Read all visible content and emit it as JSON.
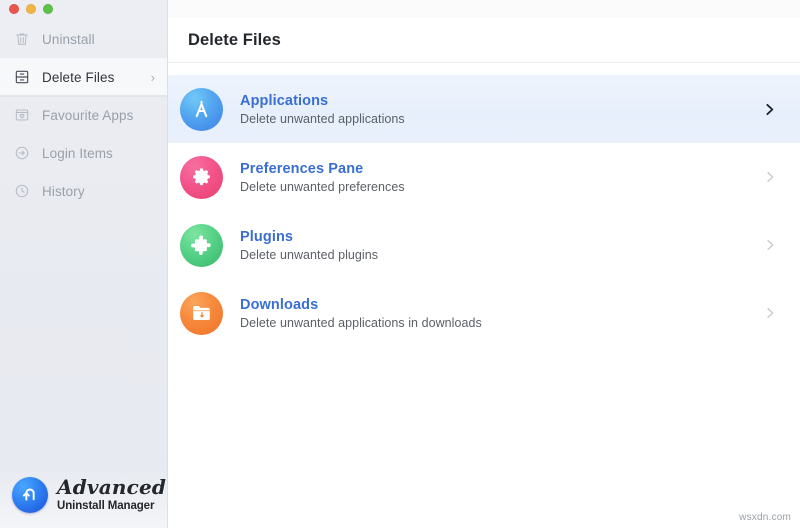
{
  "window": {
    "traffic_lights": [
      {
        "name": "close",
        "color": "#e9554c"
      },
      {
        "name": "minimize",
        "color": "#f1b344"
      },
      {
        "name": "zoom",
        "color": "#5cc149"
      }
    ]
  },
  "sidebar": {
    "items": [
      {
        "label": "Uninstall",
        "icon": "trash-icon",
        "selected": false
      },
      {
        "label": "Delete Files",
        "icon": "drawer-icon",
        "selected": true
      },
      {
        "label": "Favourite Apps",
        "icon": "heart-box-icon",
        "selected": false
      },
      {
        "label": "Login Items",
        "icon": "login-arrow-icon",
        "selected": false
      },
      {
        "label": "History",
        "icon": "clock-icon",
        "selected": false
      }
    ],
    "chevron": "›",
    "brand": {
      "logo": "u-turn-arrow-logo",
      "name": "Advanced",
      "tagline": "Uninstall Manager"
    }
  },
  "main": {
    "header": {
      "title": "Delete Files"
    },
    "rows": [
      {
        "title": "Applications",
        "subtitle": "Delete unwanted applications",
        "icon": "compass-icon",
        "icon_color": "#3d7fe8",
        "active": true
      },
      {
        "title": "Preferences Pane",
        "subtitle": "Delete unwanted preferences",
        "icon": "gear-icon",
        "icon_color": "#e8416e",
        "active": false
      },
      {
        "title": "Plugins",
        "subtitle": "Delete unwanted plugins",
        "icon": "puzzle-piece-icon",
        "icon_color": "#36b86c",
        "active": false
      },
      {
        "title": "Downloads",
        "subtitle": "Delete unwanted applications in downloads",
        "icon": "folder-download-icon",
        "icon_color": "#ef7326",
        "active": false
      }
    ]
  },
  "watermark": {
    "text": "wsxdn.com"
  },
  "colors": {
    "sidebar_bg": "#e9ebf1",
    "main_bg": "#ffffff",
    "row_title": "#3a6fd0",
    "active_row_bg": "#e9f0fc"
  }
}
